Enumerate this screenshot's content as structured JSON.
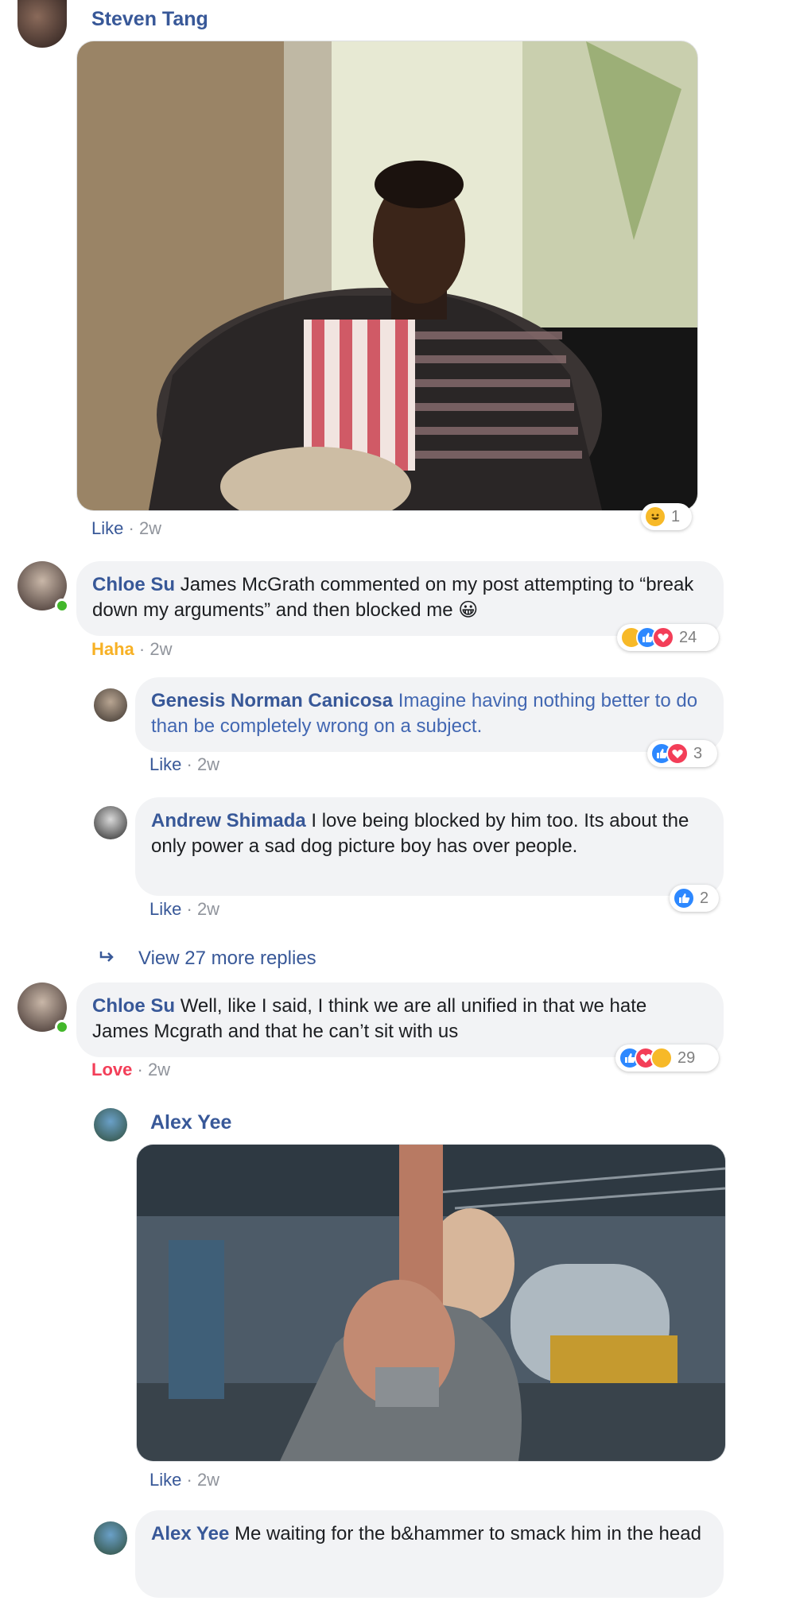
{
  "comments": [
    {
      "author": "Steven Tang",
      "action": "Like",
      "time": "2w",
      "reaction_count": "1"
    },
    {
      "author": "Chloe Su",
      "text": "James McGrath commented on my post attempting to “break down my arguments” and then blocked me 😀",
      "action": "Haha",
      "time": "2w",
      "reaction_count": "24"
    },
    {
      "author": "Genesis Norman Canicosa",
      "text": "Imagine having nothing better to do than be completely wrong on a subject.",
      "action": "Like",
      "time": "2w",
      "reaction_count": "3"
    },
    {
      "author": "Andrew Shimada",
      "text": "I love being blocked by him too. Its about the only power a sad dog picture boy has over people.",
      "action": "Like",
      "time": "2w",
      "reaction_count": "2"
    },
    {
      "author": "Chloe Su",
      "text": "Well, like I said, I think we are all unified in that we hate James Mcgrath and that he can’t sit with us",
      "action": "Love",
      "time": "2w",
      "reaction_count": "29"
    },
    {
      "author": "Alex Yee",
      "action": "Like",
      "time": "2w"
    },
    {
      "author": "Alex Yee",
      "text": "Me waiting for the b&hammer to smack him in the head"
    }
  ],
  "view_more_replies": "View 27 more replies",
  "separator": "·",
  "colors": {
    "link": "#385898",
    "bubble": "#f2f3f5",
    "online": "#42b72a",
    "haha": "#f7b125",
    "love": "#f33e58",
    "like": "#2d88ff"
  }
}
